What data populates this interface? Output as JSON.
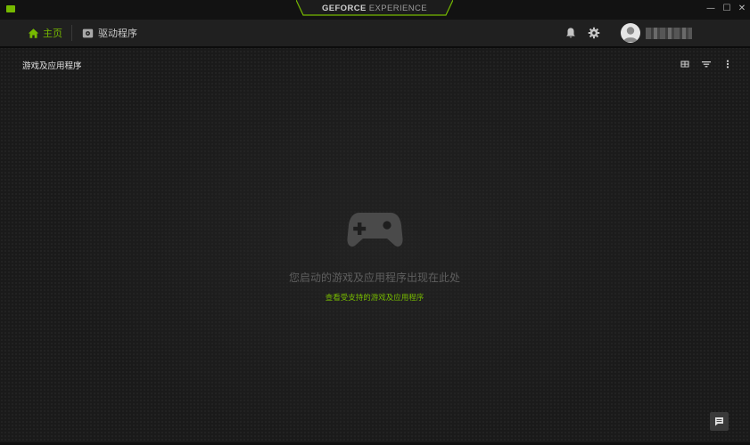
{
  "app": {
    "brand_strong": "GEFORCE",
    "brand_light": "EXPERIENCE",
    "accent_color": "#76b900"
  },
  "window_controls": {
    "minimize": "—",
    "maximize": "☐",
    "close": "✕"
  },
  "nav": {
    "tabs": [
      {
        "label": "主页",
        "icon": "home-icon",
        "active": true
      },
      {
        "label": "驱动程序",
        "icon": "driver-icon",
        "active": false
      }
    ],
    "icons": [
      "bell-icon",
      "gear-icon",
      "avatar-icon"
    ]
  },
  "section": {
    "title": "游戏及应用程序",
    "tools": [
      "grid-view-icon",
      "filter-icon",
      "more-options-icon"
    ]
  },
  "empty_state": {
    "icon": "gamepad-icon",
    "message": "您启动的游戏及应用程序出现在此处",
    "link": "查看受支持的游戏及应用程序"
  },
  "feedback": {
    "icon": "chat-icon"
  }
}
